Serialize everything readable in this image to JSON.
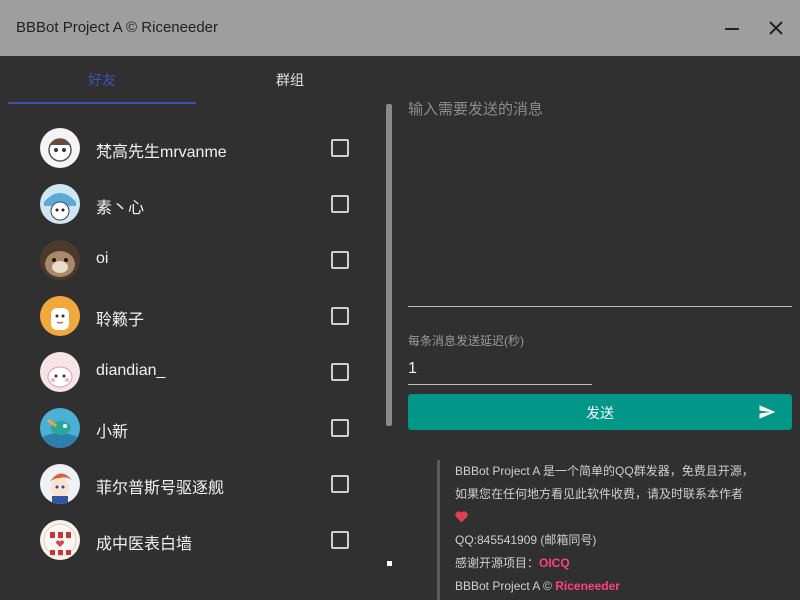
{
  "window": {
    "title": "BBBot Project A © Riceneeder"
  },
  "tabs": [
    {
      "label": "好友",
      "active": true
    },
    {
      "label": "群组",
      "active": false
    }
  ],
  "friends": [
    {
      "name": "梵高先生mrvanme",
      "checked": false
    },
    {
      "name": "素丶心",
      "checked": false
    },
    {
      "name": "oi",
      "checked": false
    },
    {
      "name": "聆籁子",
      "checked": false
    },
    {
      "name": "diandian_",
      "checked": false
    },
    {
      "name": "小新",
      "checked": false
    },
    {
      "name": "菲尔普斯号驱逐舰",
      "checked": false
    },
    {
      "name": "成中医表白墙",
      "checked": false
    }
  ],
  "message": {
    "placeholder": "输入需要发送的消息",
    "value": ""
  },
  "delay": {
    "label": "每条消息发送延迟(秒)",
    "value": "1"
  },
  "send": {
    "label": "发送"
  },
  "info": {
    "line1": "BBBot Project A 是一个简单的QQ群发器，免费且开源，如果您在任何地方看见此软件收费，请及时联系本作者",
    "qq": "QQ:845541909 (邮箱同号)",
    "thanks_prefix": "感谢开源项目：",
    "thanks_project": "OICQ",
    "copyright_prefix": "BBBot Project A © ",
    "copyright_author": "Riceneeder"
  },
  "colors": {
    "accent_tab": "#3f51b5",
    "send_button": "#009688",
    "highlight": "#ff4081",
    "background": "#303030",
    "titlebar": "#9e9e9e"
  }
}
